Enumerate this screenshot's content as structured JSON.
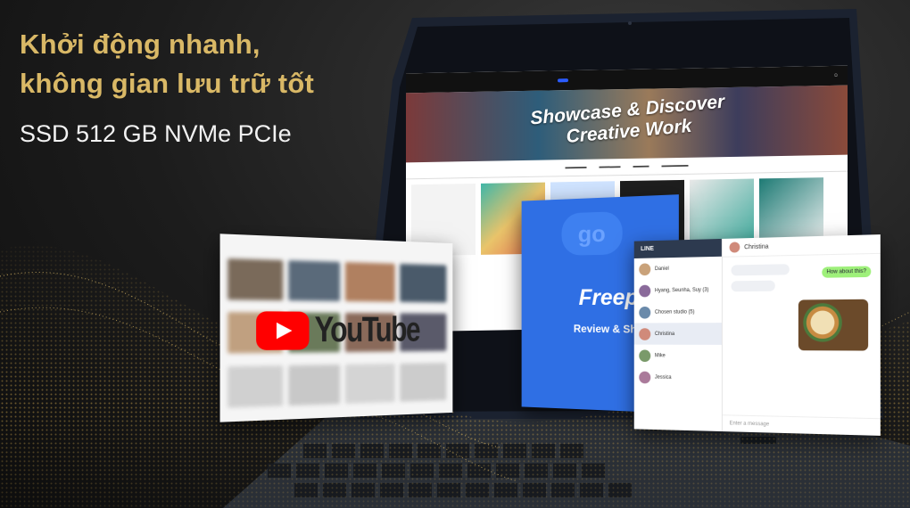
{
  "headline": {
    "line1": "Khởi động nhanh,",
    "line2": "không gian lưu trữ tốt"
  },
  "subline": "SSD 512 GB NVMe PCIe",
  "colors": {
    "headline_gold": "#d9b866",
    "background": "#1c1c1c",
    "youtube_red": "#ff0000",
    "freepik_blue": "#2f6fe4"
  },
  "screens": {
    "portfolio_site": {
      "title_line1": "Showcase & Discover",
      "title_line2": "Creative Work"
    },
    "youtube": {
      "wordmark": "YouTube"
    },
    "freepik": {
      "badge": "go",
      "name": "Freepik",
      "tagline": "Review & Share"
    },
    "line_chat": {
      "app_title": "LINE",
      "chat_title": "Christina",
      "contacts": [
        "Daniel",
        "Hyang, Seunha, Suy (3)",
        "Chosen studio (5)",
        "Christina",
        "Mike",
        "Jessica"
      ],
      "bubble_out": "How about this?",
      "input_placeholder": "Enter a message"
    }
  }
}
